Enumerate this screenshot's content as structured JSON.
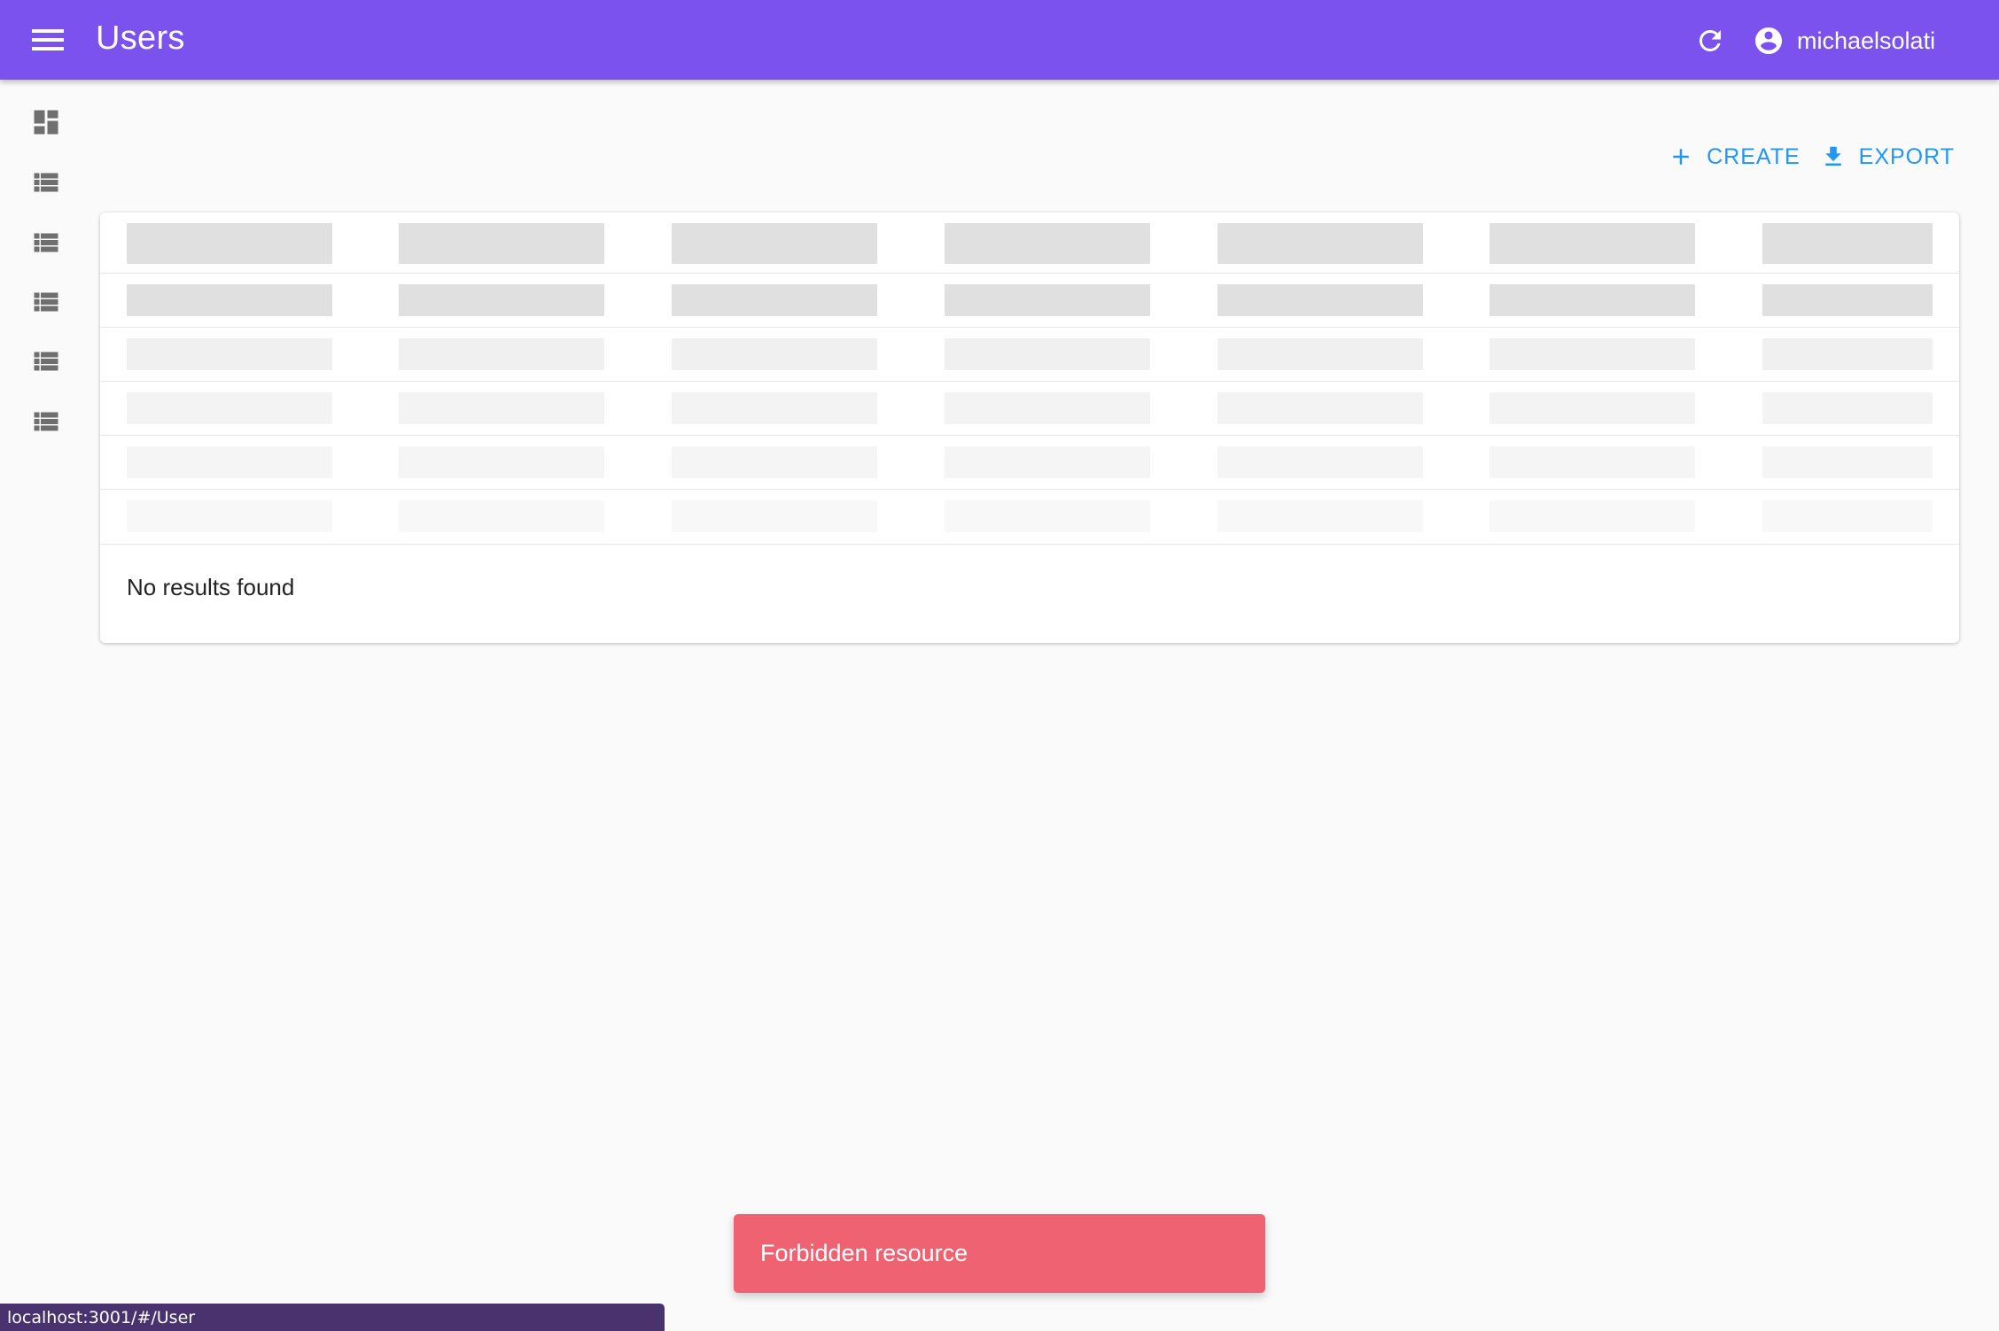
{
  "appbar": {
    "title": "Users",
    "username": "michaelsolati",
    "color": "#7b52ee"
  },
  "sidebar": {
    "items": [
      {
        "icon": "dashboard-icon"
      },
      {
        "icon": "list-icon"
      },
      {
        "icon": "list-icon"
      },
      {
        "icon": "list-icon"
      },
      {
        "icon": "list-icon"
      },
      {
        "icon": "list-icon"
      }
    ]
  },
  "toolbar": {
    "create_label": "CREATE",
    "export_label": "EXPORT",
    "accent": "#2196f3"
  },
  "table": {
    "columns": 7,
    "placeholder_rows": 6,
    "empty_text": "No results found"
  },
  "toast": {
    "message": "Forbidden resource",
    "color": "#ee6272"
  },
  "statusbar": {
    "url": "localhost:3001/#/User"
  }
}
